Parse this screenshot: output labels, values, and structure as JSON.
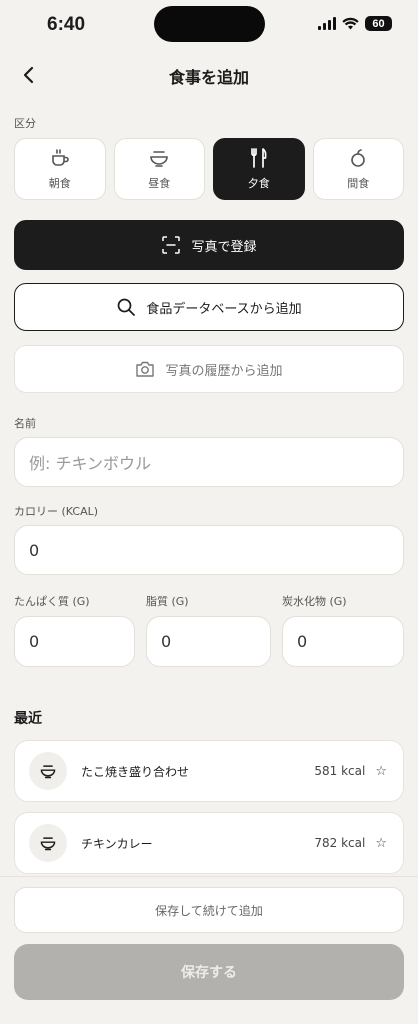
{
  "status": {
    "time": "6:40",
    "battery": "60"
  },
  "nav": {
    "title": "食事を追加"
  },
  "meal_type": {
    "label": "区分",
    "options": [
      {
        "label": "朝食",
        "icon": "coffee-cup-icon"
      },
      {
        "label": "昼食",
        "icon": "bowl-icon"
      },
      {
        "label": "夕食",
        "icon": "utensils-icon",
        "selected": true
      },
      {
        "label": "間食",
        "icon": "apple-icon"
      }
    ]
  },
  "actions": {
    "photo_register": "写真で登録",
    "food_database": "食品データベースから追加",
    "photo_history": "写真の履歴から追加"
  },
  "form": {
    "name_label": "名前",
    "name_placeholder": "例: チキンボウル",
    "calorie_label": "カロリー (KCAL)",
    "calorie_value": "0",
    "protein_label": "たんぱく質 (G)",
    "protein_value": "0",
    "fat_label": "脂質 (G)",
    "fat_value": "0",
    "carb_label": "炭水化物 (G)",
    "carb_value": "0"
  },
  "recent": {
    "title": "最近",
    "items": [
      {
        "name": "たこ焼き盛り合わせ",
        "kcal": "581 kcal",
        "star": "☆"
      },
      {
        "name": "チキンカレー",
        "kcal": "782 kcal",
        "star": "☆"
      }
    ]
  },
  "footer": {
    "save_continue": "保存して続けて追加",
    "save": "保存する"
  },
  "colors": {
    "background": "#f4f2ee",
    "primary": "#1c1c1c",
    "disabled": "#b3b1ad"
  }
}
